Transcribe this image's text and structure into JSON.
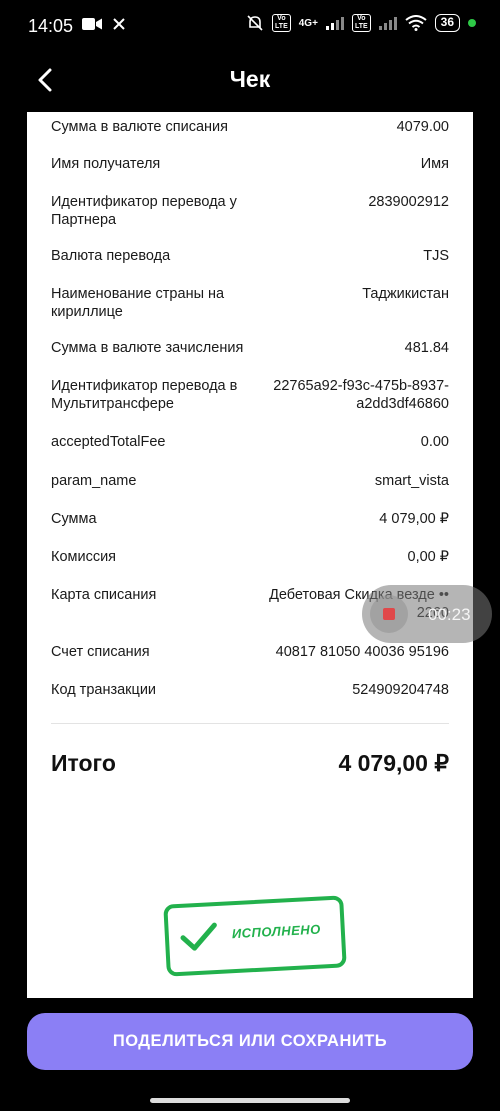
{
  "status_bar": {
    "time": "14:05",
    "network": "4G+",
    "volte": "Vo LTE",
    "battery": "36"
  },
  "header": {
    "title": "Чек"
  },
  "rows": [
    {
      "label": "Сумма в валюте списания",
      "value": "4079.00"
    },
    {
      "label": "Имя получателя",
      "value": "Имя"
    },
    {
      "label": "Идентификатор перевода у Партнера",
      "value": "2839002912"
    },
    {
      "label": "Валюта перевода",
      "value": "TJS"
    },
    {
      "label": "Наименование страны на кириллице",
      "value": "Таджикистан"
    },
    {
      "label": "Сумма в валюте зачисления",
      "value": "481.84"
    },
    {
      "label": "Идентификатор перевода в Мультитрансфере",
      "value": "22765a92-f93c-475b-8937-a2dd3df46860"
    },
    {
      "label": "acceptedTotalFee",
      "value": "0.00"
    },
    {
      "label": "param_name",
      "value": "smart_vista"
    },
    {
      "label": "Сумма",
      "value": "4 079,00 ₽"
    },
    {
      "label": "Комиссия",
      "value": "0,00 ₽"
    },
    {
      "label": "Карта списания",
      "value": "Дебетовая Скидка везде •• 2260"
    },
    {
      "label": "Счет списания",
      "value": "40817 81050 40036 95196"
    },
    {
      "label": "Код транзакции",
      "value": "524909204748"
    }
  ],
  "total": {
    "label": "Итого",
    "value": "4 079,00 ₽"
  },
  "stamp": {
    "text": "ИСПОЛНЕНО",
    "color": "#22b14c"
  },
  "recording": {
    "time": "00:23"
  },
  "share_button": {
    "label": "ПОДЕЛИТЬСЯ ИЛИ СОХРАНИТЬ",
    "color": "#8b7ff5"
  }
}
